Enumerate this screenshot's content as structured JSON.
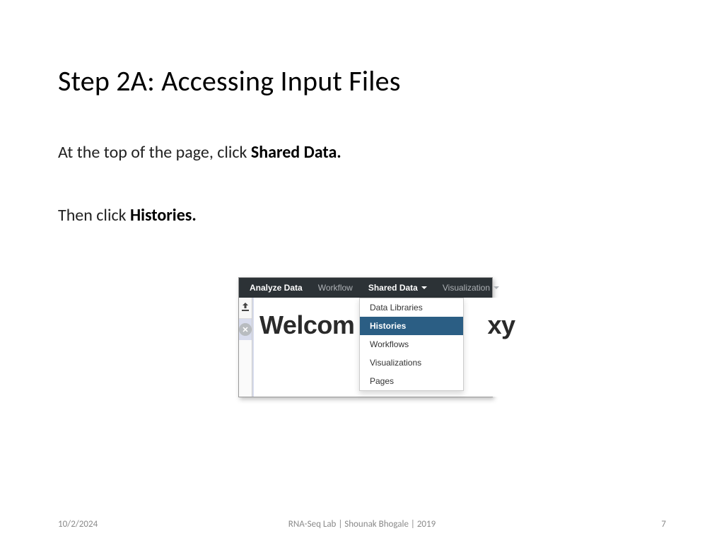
{
  "title": "Step 2A: Accessing Input Files",
  "line1_prefix": "At the top of the page, click ",
  "line1_bold": "Shared Data.",
  "line2_prefix": "Then click ",
  "line2_bold": "Histories.",
  "nav": {
    "analyze": "Analyze Data",
    "workflow": "Workflow",
    "shared": "Shared Data",
    "viz": "Visualization"
  },
  "dropdown": {
    "libraries": "Data Libraries",
    "histories": "Histories",
    "workflows": "Workflows",
    "visualizations": "Visualizations",
    "pages": "Pages"
  },
  "welcome_left": "Welcom",
  "welcome_right": "xy",
  "footer": {
    "date": "10/2/2024",
    "center": "RNA-Seq Lab  | Shounak Bhogale | 2019",
    "page": "7"
  }
}
